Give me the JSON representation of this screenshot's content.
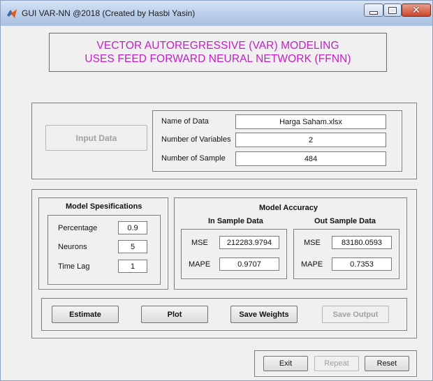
{
  "window": {
    "title": "GUI VAR-NN @2018 (Created by Hasbi Yasin)",
    "close_glyph": "✕"
  },
  "banner": {
    "line1": "VECTOR AUTOREGRESSIVE (VAR) MODELING",
    "line2": "USES FEED FORWARD NEURAL NETWORK (FFNN)"
  },
  "data_panel": {
    "input_button": "Input Data",
    "name_label": "Name of Data",
    "name_value": "Harga Saham.xlsx",
    "vars_label": "Number of Variables",
    "vars_value": "2",
    "sample_label": "Number of Sample",
    "sample_value": "484"
  },
  "model_spec": {
    "title": "Model Spesifications",
    "percentage_label": "Percentage",
    "percentage_value": "0.9",
    "neurons_label": "Neurons",
    "neurons_value": "5",
    "timelag_label": "Time Lag",
    "timelag_value": "1"
  },
  "accuracy": {
    "title": "Model Accuracy",
    "in_title": "In Sample Data",
    "out_title": "Out Sample Data",
    "mse_label": "MSE",
    "mape_label": "MAPE",
    "in_mse": "212283.9794",
    "in_mape": "0.9707",
    "out_mse": "83180.0593",
    "out_mape": "0.7353"
  },
  "actions": {
    "estimate": "Estimate",
    "plot": "Plot",
    "save_weights": "Save Weights",
    "save_output": "Save Output"
  },
  "footer": {
    "exit": "Exit",
    "repeat": "Repeat",
    "reset": "Reset"
  },
  "colors": {
    "banner_text": "#c21fc5",
    "window_bg": "#f0f0f0",
    "close_button": "#c9462c"
  }
}
